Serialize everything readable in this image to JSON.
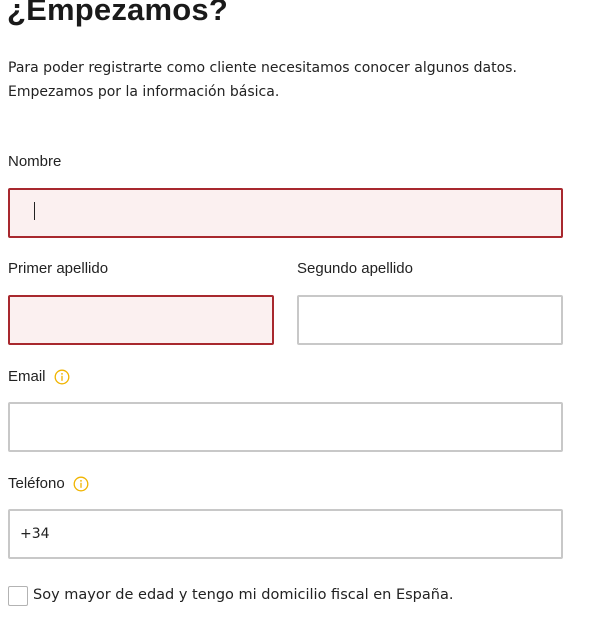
{
  "header": {
    "title": "¿Empezamos?"
  },
  "intro": {
    "line1": "Para poder registrarte como cliente necesitamos conocer algunos datos.",
    "line2": "Empezamos por la información básica."
  },
  "form": {
    "nombre": {
      "label": "Nombre",
      "value": "",
      "state": "error"
    },
    "primer_apellido": {
      "label": "Primer apellido",
      "value": "",
      "state": "error"
    },
    "segundo_apellido": {
      "label": "Segundo apellido",
      "value": ""
    },
    "email": {
      "label": "Email",
      "value": "",
      "icon": "info-icon"
    },
    "telefono": {
      "label": "Teléfono",
      "value": "+34",
      "icon": "info-icon"
    },
    "age_check": {
      "label": "Soy mayor de edad y tengo mi domicilio fiscal en España.",
      "checked": false
    }
  },
  "colors": {
    "error_border": "#a8282e",
    "error_background": "#fbf0f0",
    "default_border": "#c8c8c8",
    "info_icon": "#f0b400"
  }
}
